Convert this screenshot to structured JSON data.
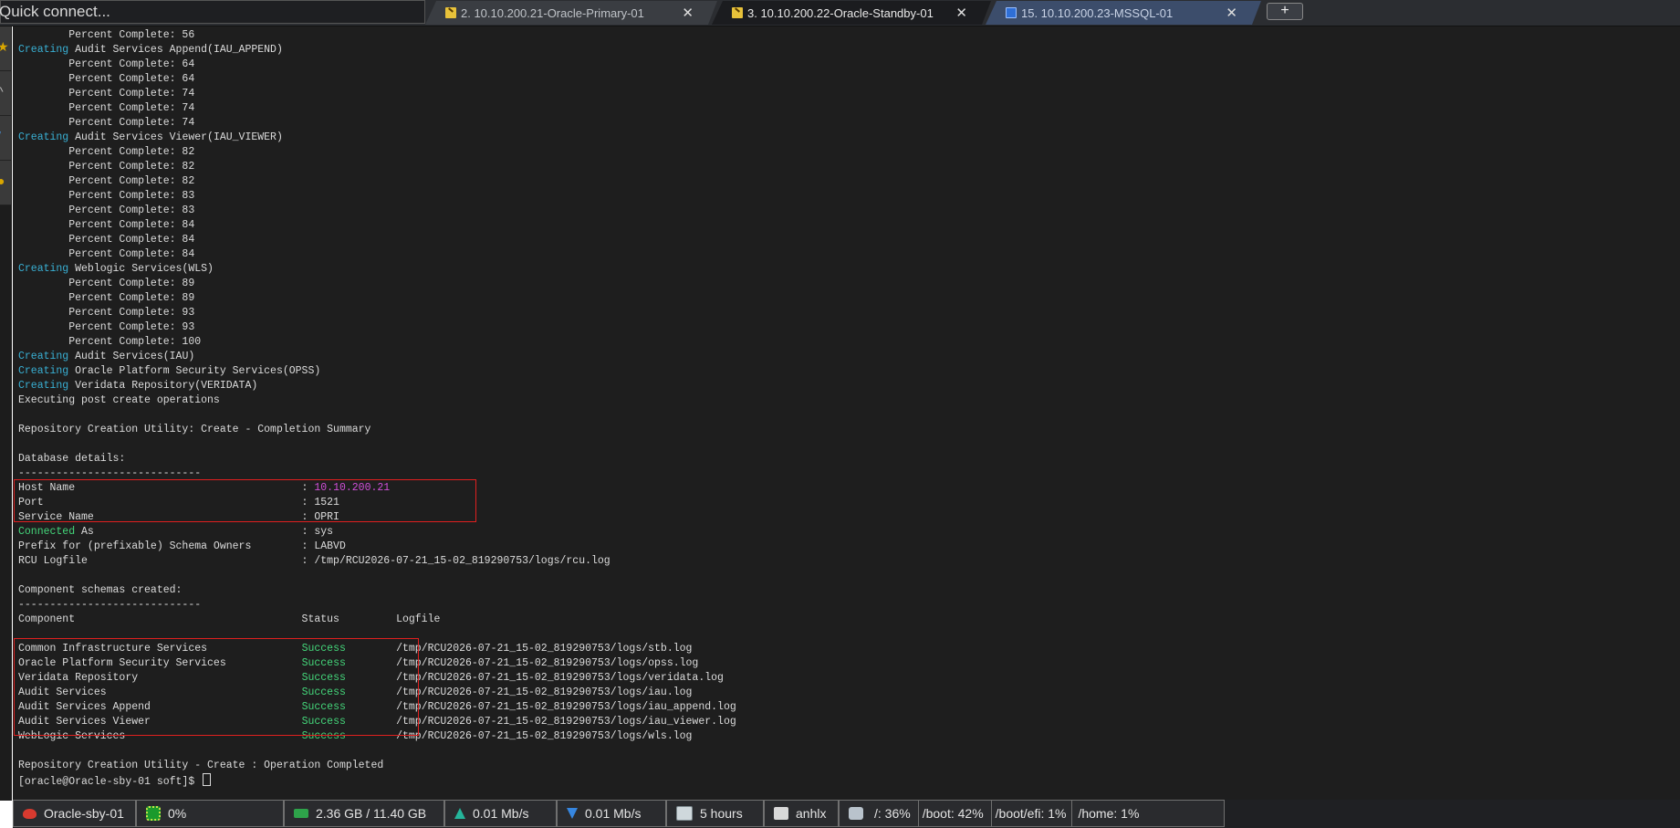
{
  "quick_connect": {
    "placeholder": "Quick connect..."
  },
  "tabs": [
    {
      "label": "2. 10.10.200.21-Oracle-Primary-01",
      "icon": "oracle-key-icon",
      "active": false
    },
    {
      "label": "3. 10.10.200.22-Oracle-Standby-01",
      "icon": "oracle-key-icon",
      "active": true
    },
    {
      "label": "15. 10.10.200.23-MSSQL-01",
      "icon": "windows-icon",
      "active": false
    }
  ],
  "new_tab_label": "+",
  "close_glyph": "✕",
  "terminal": {
    "lines": [
      [
        {
          "t": "        Percent Complete: 56"
        }
      ],
      [
        {
          "t": "Creating",
          "c": "kw-c"
        },
        {
          "t": " Audit Services Append(IAU_APPEND)"
        }
      ],
      [
        {
          "t": "        Percent Complete: 64"
        }
      ],
      [
        {
          "t": "        Percent Complete: 64"
        }
      ],
      [
        {
          "t": "        Percent Complete: 74"
        }
      ],
      [
        {
          "t": "        Percent Complete: 74"
        }
      ],
      [
        {
          "t": "        Percent Complete: 74"
        }
      ],
      [
        {
          "t": "Creating",
          "c": "kw-c"
        },
        {
          "t": " Audit Services Viewer(IAU_VIEWER)"
        }
      ],
      [
        {
          "t": "        Percent Complete: 82"
        }
      ],
      [
        {
          "t": "        Percent Complete: 82"
        }
      ],
      [
        {
          "t": "        Percent Complete: 82"
        }
      ],
      [
        {
          "t": "        Percent Complete: 83"
        }
      ],
      [
        {
          "t": "        Percent Complete: 83"
        }
      ],
      [
        {
          "t": "        Percent Complete: 84"
        }
      ],
      [
        {
          "t": "        Percent Complete: 84"
        }
      ],
      [
        {
          "t": "        Percent Complete: 84"
        }
      ],
      [
        {
          "t": "Creating",
          "c": "kw-c"
        },
        {
          "t": " Weblogic Services(WLS)"
        }
      ],
      [
        {
          "t": "        Percent Complete: 89"
        }
      ],
      [
        {
          "t": "        Percent Complete: 89"
        }
      ],
      [
        {
          "t": "        Percent Complete: 93"
        }
      ],
      [
        {
          "t": "        Percent Complete: 93"
        }
      ],
      [
        {
          "t": "        Percent Complete: 100"
        }
      ],
      [
        {
          "t": "Creating",
          "c": "kw-c"
        },
        {
          "t": " Audit Services(IAU)"
        }
      ],
      [
        {
          "t": "Creating",
          "c": "kw-c"
        },
        {
          "t": " Oracle Platform Security Services(OPSS)"
        }
      ],
      [
        {
          "t": "Creating",
          "c": "kw-c"
        },
        {
          "t": " Veridata Repository(VERIDATA)"
        }
      ],
      [
        {
          "t": "Executing post create operations"
        }
      ],
      [
        {
          "t": ""
        }
      ],
      [
        {
          "t": "Repository Creation Utility: Create - Completion Summary"
        }
      ],
      [
        {
          "t": ""
        }
      ],
      [
        {
          "t": "Database details:"
        }
      ],
      [
        {
          "t": "-----------------------------"
        }
      ],
      [
        {
          "t": "Host Name                                    : "
        },
        {
          "t": "10.10.200.21",
          "c": "kw-m"
        }
      ],
      [
        {
          "t": "Port                                         : 1521"
        }
      ],
      [
        {
          "t": "Service Name                                 : OPRI"
        }
      ],
      [
        {
          "t": "Connected",
          "c": "kw-g"
        },
        {
          "t": " As                                 : sys"
        }
      ],
      [
        {
          "t": "Prefix for (prefixable) Schema Owners        : LABVD"
        }
      ],
      [
        {
          "t": "RCU Logfile                                  : /tmp/RCU2026-07-21_15-02_819290753/logs/rcu.log"
        }
      ],
      [
        {
          "t": ""
        }
      ],
      [
        {
          "t": "Component schemas created:"
        }
      ],
      [
        {
          "t": "-----------------------------"
        }
      ],
      [
        {
          "t": "Component                                    Status         Logfile"
        }
      ],
      [
        {
          "t": ""
        }
      ],
      [
        {
          "t": "Common Infrastructure Services               "
        },
        {
          "t": "Success",
          "c": "kw-g"
        },
        {
          "t": "        /tmp/RCU2026-07-21_15-02_819290753/logs/stb.log"
        }
      ],
      [
        {
          "t": "Oracle Platform Security Services            "
        },
        {
          "t": "Success",
          "c": "kw-g"
        },
        {
          "t": "        /tmp/RCU2026-07-21_15-02_819290753/logs/opss.log"
        }
      ],
      [
        {
          "t": "Veridata Repository                          "
        },
        {
          "t": "Success",
          "c": "kw-g"
        },
        {
          "t": "        /tmp/RCU2026-07-21_15-02_819290753/logs/veridata.log"
        }
      ],
      [
        {
          "t": "Audit Services                               "
        },
        {
          "t": "Success",
          "c": "kw-g"
        },
        {
          "t": "        /tmp/RCU2026-07-21_15-02_819290753/logs/iau.log"
        }
      ],
      [
        {
          "t": "Audit Services Append                        "
        },
        {
          "t": "Success",
          "c": "kw-g"
        },
        {
          "t": "        /tmp/RCU2026-07-21_15-02_819290753/logs/iau_append.log"
        }
      ],
      [
        {
          "t": "Audit Services Viewer                        "
        },
        {
          "t": "Success",
          "c": "kw-g"
        },
        {
          "t": "        /tmp/RCU2026-07-21_15-02_819290753/logs/iau_viewer.log"
        }
      ],
      [
        {
          "t": "WebLogic Services                            "
        },
        {
          "t": "Success",
          "c": "kw-g"
        },
        {
          "t": "        /tmp/RCU2026-07-21_15-02_819290753/logs/wls.log"
        }
      ],
      [
        {
          "t": ""
        }
      ],
      [
        {
          "t": "Repository Creation Utility - Create : Operation Completed"
        }
      ],
      [
        {
          "t": "[oracle@Oracle-sby-01 soft]$ "
        }
      ]
    ],
    "colors": {
      "background": "#1e1e1e",
      "text": "#dcdcdc",
      "creating": "#39b0d4",
      "success": "#44d67a",
      "host": "#d14fd8",
      "highlight": "#e0201f"
    }
  },
  "status_bar": {
    "hostname": "Oracle-sby-01",
    "cpu": "0%",
    "memory": "2.36 GB / 11.40 GB",
    "upload": "0.01 Mb/s",
    "download": "0.01 Mb/s",
    "uptime": "5 hours",
    "user": "anhlx",
    "disks": {
      "root": "/: 36%",
      "boot": "/boot: 42%",
      "boot_efi": "/boot/efi: 1%",
      "home": "/home: 1%"
    }
  }
}
